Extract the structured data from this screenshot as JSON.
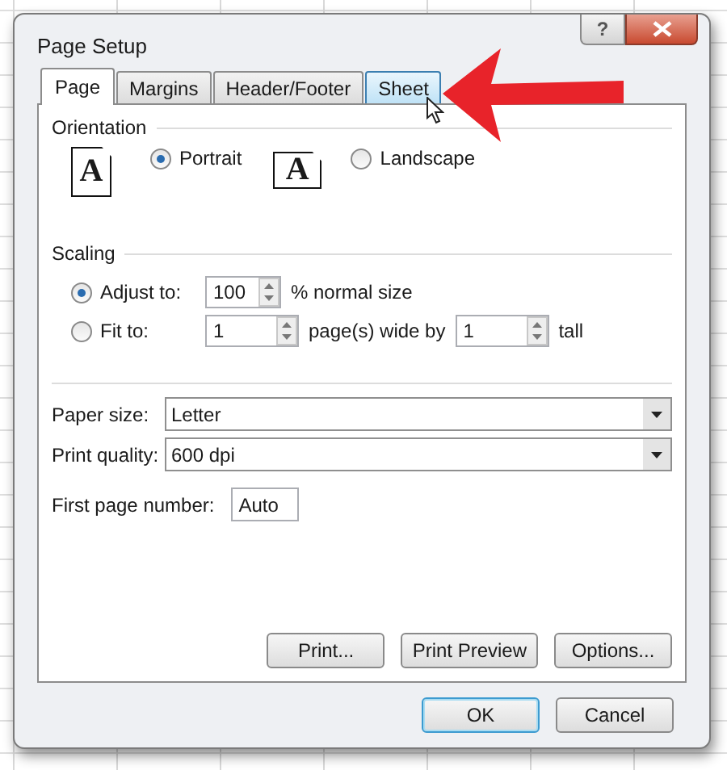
{
  "window": {
    "title": "Page Setup",
    "help_label": "?"
  },
  "tabs": [
    {
      "label": "Page",
      "selected": true,
      "hovered": false
    },
    {
      "label": "Margins",
      "selected": false,
      "hovered": false
    },
    {
      "label": "Header/Footer",
      "selected": false,
      "hovered": false
    },
    {
      "label": "Sheet",
      "selected": false,
      "hovered": true
    }
  ],
  "orientation": {
    "title": "Orientation",
    "options": [
      {
        "kind": "portrait",
        "label": "Portrait",
        "icon_letter": "A",
        "selected": true
      },
      {
        "kind": "landscape",
        "label": "Landscape",
        "icon_letter": "A",
        "selected": false
      }
    ]
  },
  "scaling": {
    "title": "Scaling",
    "options": [
      {
        "kind": "adjust",
        "label": "Adjust to:",
        "selected": true,
        "value": "100",
        "suffix": "% normal size"
      },
      {
        "kind": "fit",
        "label": "Fit to:",
        "selected": false,
        "wide_value": "1",
        "wide_suffix": "page(s) wide by",
        "tall_value": "1",
        "tall_suffix": "tall"
      }
    ]
  },
  "paper_size": {
    "label": "Paper size:",
    "value": "Letter"
  },
  "print_quality": {
    "label": "Print quality:",
    "value": "600 dpi"
  },
  "first_page_number": {
    "label": "First page number:",
    "value": "Auto"
  },
  "panel_buttons": [
    "Print...",
    "Print Preview",
    "Options..."
  ],
  "footer_buttons": [
    {
      "label": "OK",
      "default": true
    },
    {
      "label": "Cancel",
      "default": false
    }
  ]
}
